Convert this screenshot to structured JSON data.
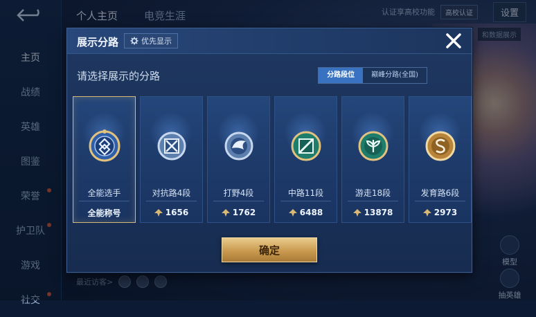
{
  "top": {
    "tabs": [
      {
        "label": "个人主页"
      },
      {
        "label": "电竞生涯"
      }
    ],
    "notice": "认证享高校功能",
    "school_btn": "高校认证",
    "settings": "设置",
    "right_pill": "和数据展示"
  },
  "sidebar": {
    "items": [
      {
        "label": "主页"
      },
      {
        "label": "战绩"
      },
      {
        "label": "英雄"
      },
      {
        "label": "图鉴"
      },
      {
        "label": "荣誉"
      },
      {
        "label": "护卫队"
      },
      {
        "label": "游戏"
      },
      {
        "label": "社交"
      }
    ]
  },
  "footer": {
    "visitors_label": "最近访客>"
  },
  "right_bottom": {
    "item1": "模型",
    "item2": "抽英雄"
  },
  "modal": {
    "title": "展示分路",
    "priority_label": "优先显示",
    "subtitle": "请选择展示的分路",
    "segments": [
      {
        "label": "分路段位"
      },
      {
        "label": "巅峰分路(全国)"
      }
    ],
    "cards": [
      {
        "name": "全能选手",
        "foot": "全能称号",
        "icon": "all-round-emblem-icon"
      },
      {
        "name": "对抗路4段",
        "value": "1656",
        "icon": "clash-lane-emblem-icon"
      },
      {
        "name": "打野4段",
        "value": "1762",
        "icon": "jungle-emblem-icon"
      },
      {
        "name": "中路11段",
        "value": "6488",
        "icon": "mid-lane-emblem-icon"
      },
      {
        "name": "游走18段",
        "value": "13878",
        "icon": "roam-emblem-icon"
      },
      {
        "name": "发育路6段",
        "value": "2973",
        "icon": "farm-lane-emblem-icon"
      }
    ],
    "confirm_label": "确定"
  },
  "colors": {
    "accent_gold": "#d8b874",
    "segment_active": "#3a72c2"
  }
}
